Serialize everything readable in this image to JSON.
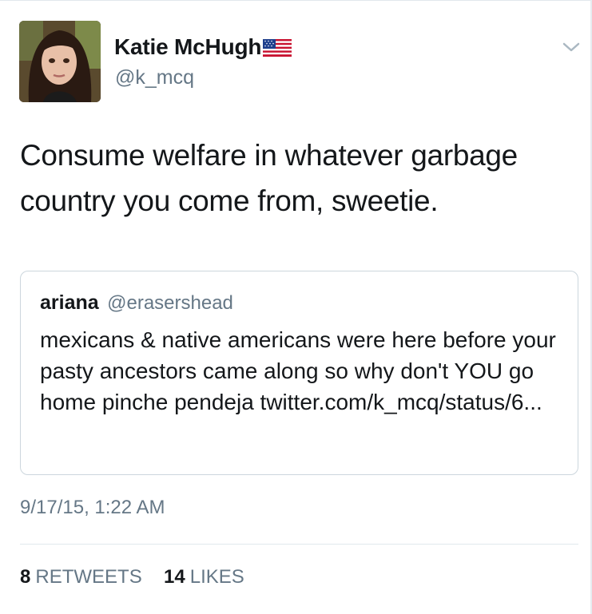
{
  "author": {
    "display_name": "Katie McHugh",
    "handle": "@k_mcq",
    "flag_icon": "us-flag-icon"
  },
  "menu": {
    "icon": "chevron-down-icon"
  },
  "tweet": {
    "text": "Consume welfare in whatever garbage country you come from, sweetie."
  },
  "quoted_tweet": {
    "display_name": "ariana",
    "handle": "@erasershead",
    "text": "mexicans & native americans were here before your pasty ancestors came along so why don't YOU go home pinche pendeja twitter.com/k_mcq/status/6..."
  },
  "timestamp": "9/17/15, 1:22 AM",
  "stats": {
    "retweets_count": "8",
    "retweets_label": "RETWEETS",
    "likes_count": "14",
    "likes_label": "LIKES"
  },
  "colors": {
    "text_primary": "#14171a",
    "text_secondary": "#657786",
    "border": "#ccd6dd"
  }
}
